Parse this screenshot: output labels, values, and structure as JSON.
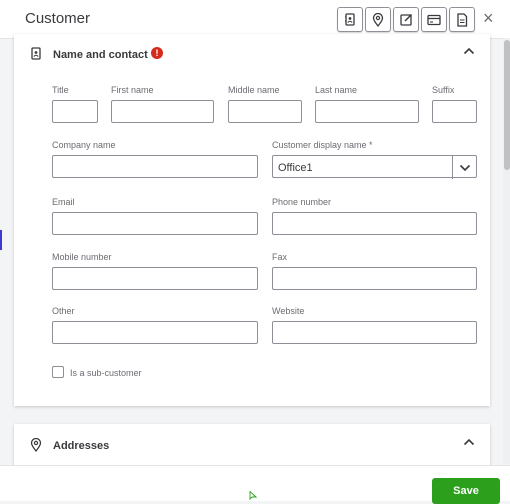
{
  "window": {
    "title": "Customer",
    "close_label": "×"
  },
  "toolbar": {
    "icons": [
      "contact-card-icon",
      "location-pin-icon",
      "edit-note-icon",
      "payment-card-icon",
      "document-icon"
    ]
  },
  "name_contact": {
    "title": "Name and contact",
    "alert": "!",
    "fields": {
      "title": {
        "label": "Title",
        "value": ""
      },
      "first_name": {
        "label": "First name",
        "value": ""
      },
      "middle_name": {
        "label": "Middle name",
        "value": ""
      },
      "last_name": {
        "label": "Last name",
        "value": ""
      },
      "suffix": {
        "label": "Suffix",
        "value": ""
      },
      "company_name": {
        "label": "Company name",
        "value": ""
      },
      "display_name": {
        "label": "Customer display name *",
        "value": "Office1"
      },
      "email": {
        "label": "Email",
        "value": ""
      },
      "phone": {
        "label": "Phone number",
        "value": ""
      },
      "mobile": {
        "label": "Mobile number",
        "value": ""
      },
      "fax": {
        "label": "Fax",
        "value": ""
      },
      "other": {
        "label": "Other",
        "value": ""
      },
      "website": {
        "label": "Website",
        "value": ""
      }
    },
    "sub_customer": {
      "label": "Is a sub-customer",
      "checked": false
    }
  },
  "addresses": {
    "title": "Addresses"
  },
  "footer": {
    "save_label": "Save"
  },
  "colors": {
    "accent": "#2ca01c",
    "alert": "#d52b1e",
    "border": "#8d9096"
  }
}
